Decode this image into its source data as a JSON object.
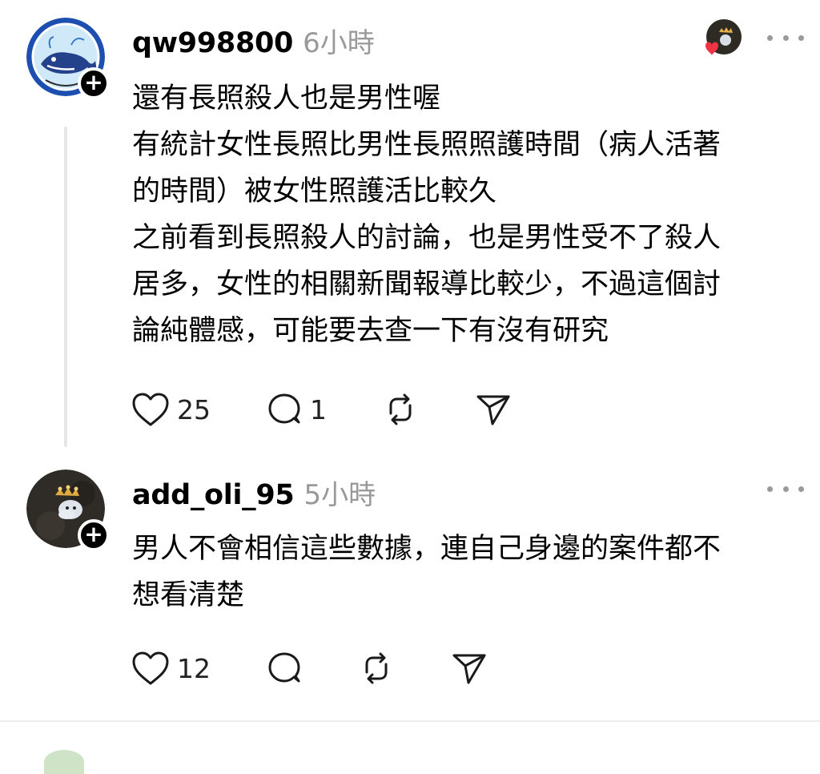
{
  "posts": [
    {
      "username": "qw998800",
      "time": "6小時",
      "lines": [
        "還有長照殺人也是男性喔",
        "有統計女性長照比男性長照照護時間（病人活著",
        "的時間）被女性照護活比較久",
        "之前看到長照殺人的討論，也是男性受不了殺人",
        "居多，女性的相關新聞報導比較少，不過這個討",
        "論純體感，可能要去查一下有沒有研究"
      ],
      "like_count": "25",
      "comment_count": "1",
      "avatar_icon": "whale-avatar",
      "reply_avatar_icon": "crown-avatar-with-heart"
    },
    {
      "username": "add_oli_95",
      "time": "5小時",
      "lines": [
        "男人不會相信這些數據，連自己身邊的案件都不",
        "想看清楚"
      ],
      "like_count": "12",
      "comment_count": "",
      "avatar_icon": "crown-avatar"
    }
  ],
  "icons": {
    "follow": "+",
    "like": "heart-icon",
    "comment": "comment-bubble-icon",
    "repost": "repost-icon",
    "share": "send-icon",
    "more": "more-dots-icon"
  },
  "colors": {
    "text": "#000000",
    "muted": "#999999",
    "heart": "#ee3344",
    "divider": "#ececec",
    "thread_line": "#e6e6e6"
  }
}
